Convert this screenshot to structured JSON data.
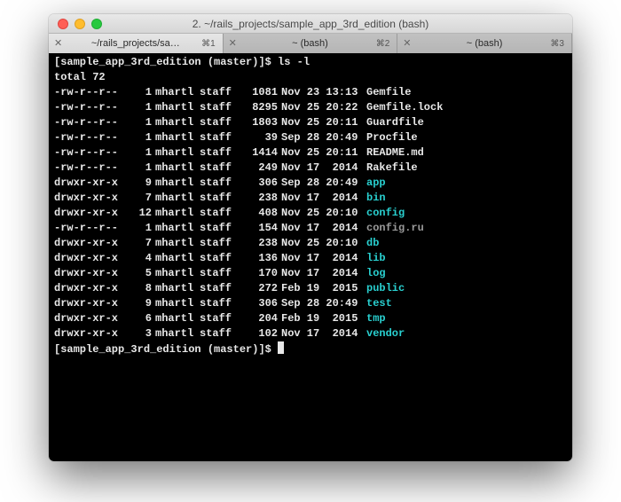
{
  "window": {
    "title": "2. ~/rails_projects/sample_app_3rd_edition (bash)"
  },
  "tabs": [
    {
      "label": "~/rails_projects/sa…",
      "shortcut": "⌘1",
      "active": true
    },
    {
      "label": "~ (bash)",
      "shortcut": "⌘2",
      "active": false
    },
    {
      "label": "~ (bash)",
      "shortcut": "⌘3",
      "active": false
    }
  ],
  "terminal": {
    "prompt": "[sample_app_3rd_edition (master)]$",
    "command": "ls -l",
    "total_line": "total 72",
    "entries": [
      {
        "perm": "-rw-r--r--",
        "links": "1",
        "owner": "mhartl",
        "group": "staff",
        "size": "1081",
        "date": "Nov 23 13:13",
        "name": "Gemfile",
        "kind": "plain"
      },
      {
        "perm": "-rw-r--r--",
        "links": "1",
        "owner": "mhartl",
        "group": "staff",
        "size": "8295",
        "date": "Nov 25 20:22",
        "name": "Gemfile.lock",
        "kind": "plain"
      },
      {
        "perm": "-rw-r--r--",
        "links": "1",
        "owner": "mhartl",
        "group": "staff",
        "size": "1803",
        "date": "Nov 25 20:11",
        "name": "Guardfile",
        "kind": "plain"
      },
      {
        "perm": "-rw-r--r--",
        "links": "1",
        "owner": "mhartl",
        "group": "staff",
        "size": "39",
        "date": "Sep 28 20:49",
        "name": "Procfile",
        "kind": "plain"
      },
      {
        "perm": "-rw-r--r--",
        "links": "1",
        "owner": "mhartl",
        "group": "staff",
        "size": "1414",
        "date": "Nov 25 20:11",
        "name": "README.md",
        "kind": "plain"
      },
      {
        "perm": "-rw-r--r--",
        "links": "1",
        "owner": "mhartl",
        "group": "staff",
        "size": "249",
        "date": "Nov 17  2014",
        "name": "Rakefile",
        "kind": "plain"
      },
      {
        "perm": "drwxr-xr-x",
        "links": "9",
        "owner": "mhartl",
        "group": "staff",
        "size": "306",
        "date": "Sep 28 20:49",
        "name": "app",
        "kind": "dir"
      },
      {
        "perm": "drwxr-xr-x",
        "links": "7",
        "owner": "mhartl",
        "group": "staff",
        "size": "238",
        "date": "Nov 17  2014",
        "name": "bin",
        "kind": "dir"
      },
      {
        "perm": "drwxr-xr-x",
        "links": "12",
        "owner": "mhartl",
        "group": "staff",
        "size": "408",
        "date": "Nov 25 20:10",
        "name": "config",
        "kind": "dir"
      },
      {
        "perm": "-rw-r--r--",
        "links": "1",
        "owner": "mhartl",
        "group": "staff",
        "size": "154",
        "date": "Nov 17  2014",
        "name": "config.ru",
        "kind": "grey"
      },
      {
        "perm": "drwxr-xr-x",
        "links": "7",
        "owner": "mhartl",
        "group": "staff",
        "size": "238",
        "date": "Nov 25 20:10",
        "name": "db",
        "kind": "dir"
      },
      {
        "perm": "drwxr-xr-x",
        "links": "4",
        "owner": "mhartl",
        "group": "staff",
        "size": "136",
        "date": "Nov 17  2014",
        "name": "lib",
        "kind": "dir"
      },
      {
        "perm": "drwxr-xr-x",
        "links": "5",
        "owner": "mhartl",
        "group": "staff",
        "size": "170",
        "date": "Nov 17  2014",
        "name": "log",
        "kind": "dir"
      },
      {
        "perm": "drwxr-xr-x",
        "links": "8",
        "owner": "mhartl",
        "group": "staff",
        "size": "272",
        "date": "Feb 19  2015",
        "name": "public",
        "kind": "dir"
      },
      {
        "perm": "drwxr-xr-x",
        "links": "9",
        "owner": "mhartl",
        "group": "staff",
        "size": "306",
        "date": "Sep 28 20:49",
        "name": "test",
        "kind": "dir"
      },
      {
        "perm": "drwxr-xr-x",
        "links": "6",
        "owner": "mhartl",
        "group": "staff",
        "size": "204",
        "date": "Feb 19  2015",
        "name": "tmp",
        "kind": "dir"
      },
      {
        "perm": "drwxr-xr-x",
        "links": "3",
        "owner": "mhartl",
        "group": "staff",
        "size": "102",
        "date": "Nov 17  2014",
        "name": "vendor",
        "kind": "dir"
      }
    ]
  }
}
